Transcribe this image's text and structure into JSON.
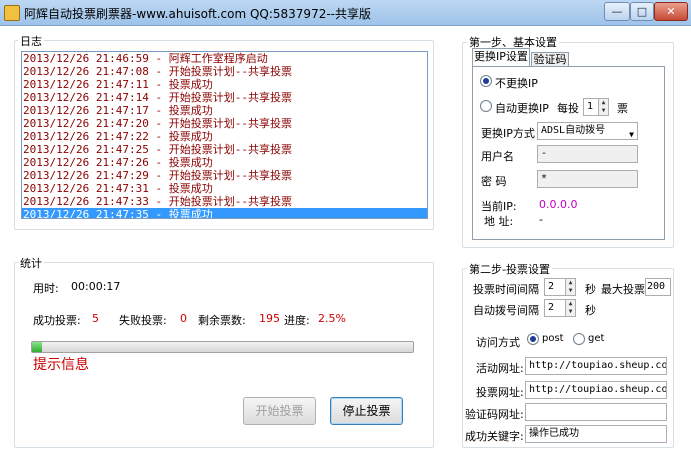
{
  "window": {
    "title": "阿辉自动投票刷票器-www.ahuisoft.com QQ:5837972--共享版",
    "min_label": "—",
    "max_label": "□",
    "close_label": "✕"
  },
  "log": {
    "title": "日志",
    "lines": [
      "2013/12/26 21:46:59  -  阿辉工作室程序启动",
      "2013/12/26 21:47:08  -  开始投票计划--共享投票",
      "2013/12/26 21:47:11  -  投票成功",
      "2013/12/26 21:47:14  -  开始投票计划--共享投票",
      "2013/12/26 21:47:17  -  投票成功",
      "2013/12/26 21:47:20  -  开始投票计划--共享投票",
      "2013/12/26 21:47:22  -  投票成功",
      "2013/12/26 21:47:25  -  开始投票计划--共享投票",
      "2013/12/26 21:47:26  -  投票成功",
      "2013/12/26 21:47:29  -  开始投票计划--共享投票",
      "2013/12/26 21:47:31  -  投票成功",
      "2013/12/26 21:47:33  -  开始投票计划--共享投票",
      "2013/12/26 21:47:35  -  投票成功"
    ],
    "selected_index": 12
  },
  "stats": {
    "title": "统计",
    "time_label": "用时:",
    "time_value": "00:00:17",
    "success_label": "成功投票:",
    "success_value": "5",
    "fail_label": "失败投票:",
    "fail_value": "0",
    "remaining_label": "剩余票数:",
    "remaining_value": "195",
    "progress_label": "进度:",
    "progress_value": "2.5%",
    "progress_fraction": 0.025,
    "hint": "提示信息"
  },
  "actions": {
    "start_label": "开始投票",
    "stop_label": "停止投票"
  },
  "step1": {
    "title": "第一步、基本设置",
    "tabs": [
      "更换IP设置",
      "验证码"
    ],
    "no_change_ip": "不更换IP",
    "auto_change_ip": "自动更换IP",
    "every_label": "每投",
    "every_value": "1",
    "ticket_unit": "票",
    "method_label": "更换IP方式",
    "method_value": "ADSL自动拨号",
    "user_label": "用户名",
    "user_value": "-",
    "password_label": "密  码",
    "password_value": "*",
    "current_ip_label": "当前IP:",
    "current_ip_value": "0.0.0.0",
    "address_label": "地  址:",
    "address_value": "-"
  },
  "step2": {
    "title": "第二步-投票设置",
    "interval_label": "投票时间间隔",
    "interval_value": "2",
    "sec_unit": "秒",
    "max_label": "最大投票",
    "max_value": "200",
    "redial_label": "自动拨号间隔",
    "redial_value": "2",
    "sec_unit2": "秒",
    "method_label": "访问方式",
    "post_label": "post",
    "get_label": "get",
    "activity_url_label": "活动网址:",
    "activity_url_value": "http://toupiao.sheup.com/",
    "vote_url_label": "投票网址:",
    "vote_url_value": "http://toupiao.sheup.com/ac",
    "captcha_url_label": "验证码网址:",
    "captcha_url_value": "",
    "success_keyword_label": "成功关键字:",
    "success_keyword_value": "操作已成功"
  }
}
